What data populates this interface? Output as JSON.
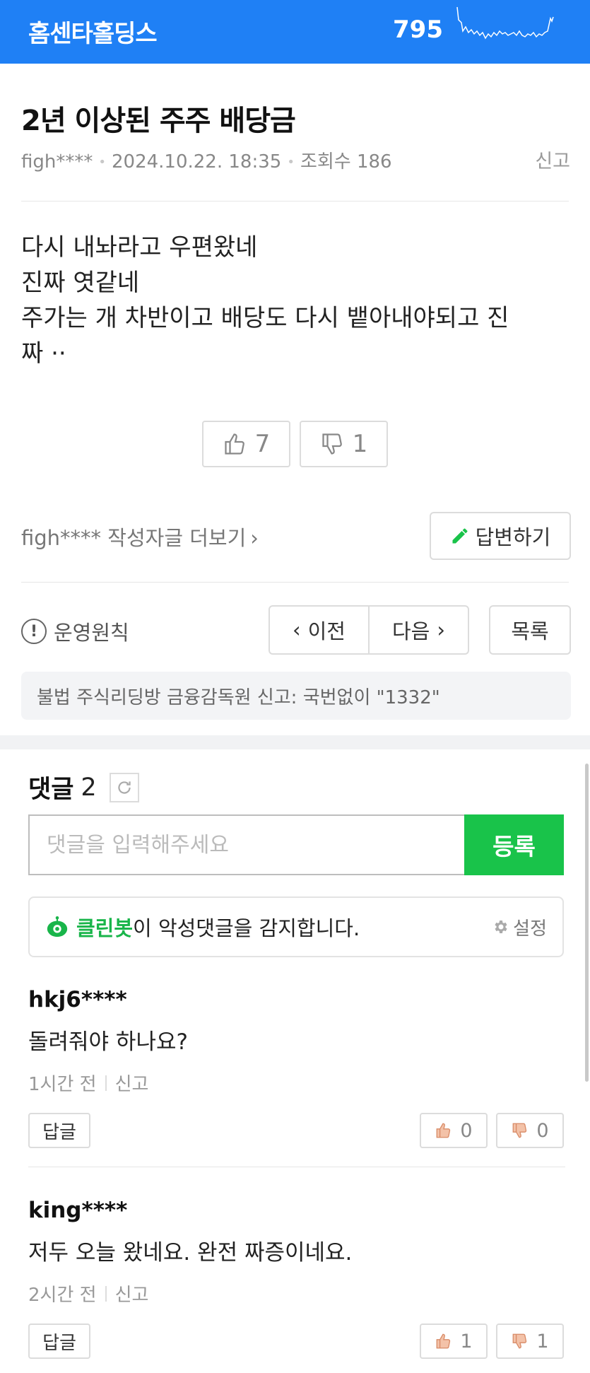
{
  "header": {
    "stock_name": "홈센타홀딩스",
    "price": "795",
    "background_color": "#1f80f5"
  },
  "post": {
    "title": "2년 이상된 주주 배당금",
    "author": "figh****",
    "date": "2024.10.22. 18:35",
    "views": "조회수 186",
    "report_label": "신고",
    "body_lines": [
      "다시 내놔라고 우편왔네",
      "진짜 엿같네",
      "주가는 개 차반이고 배당도 다시 뱉아내야되고 진",
      "짜 ··"
    ],
    "likes": "7",
    "dislikes": "1",
    "author_more_label": "figh**** 작성자글 더보기",
    "reply_label": "답변하기"
  },
  "nav": {
    "rules_label": "운영원칙",
    "prev_label": "이전",
    "next_label": "다음",
    "list_label": "목록"
  },
  "notice": {
    "text": "불법 주식리딩방 금융감독원 신고: 국번없이 \"1332\""
  },
  "comments": {
    "label": "댓글",
    "count": "2",
    "input_placeholder": "댓글을 입력해주세요",
    "submit_label": "등록",
    "cleanbot_brand": "클린봇",
    "cleanbot_message": "이 악성댓글을 감지합니다.",
    "settings_label": "설정",
    "accent_color": "#19c34a",
    "items": [
      {
        "user": "hkj6****",
        "text": "돌려줘야 하나요?",
        "time": "1시간 전",
        "report": "신고",
        "reply": "답글",
        "likes": "0",
        "dislikes": "0"
      },
      {
        "user": "king****",
        "text": "저두 오늘 왔네요. 완전 짜증이네요.",
        "time": "2시간 전",
        "report": "신고",
        "reply": "답글",
        "likes": "1",
        "dislikes": "1"
      }
    ]
  }
}
